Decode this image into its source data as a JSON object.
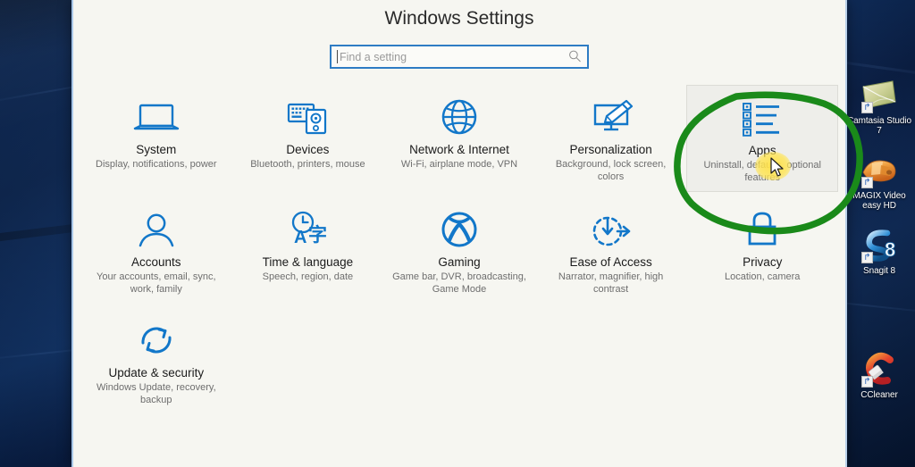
{
  "window": {
    "title": "Windows Settings"
  },
  "search": {
    "placeholder": "Find a setting",
    "value": "",
    "icon": "search-icon"
  },
  "tiles": [
    {
      "id": "system",
      "icon": "laptop-icon",
      "title": "System",
      "desc": "Display, notifications, power",
      "hover": false
    },
    {
      "id": "devices",
      "icon": "keyboard-device-icon",
      "title": "Devices",
      "desc": "Bluetooth, printers, mouse",
      "hover": false
    },
    {
      "id": "network-internet",
      "icon": "globe-icon",
      "title": "Network & Internet",
      "desc": "Wi-Fi, airplane mode, VPN",
      "hover": false
    },
    {
      "id": "personalization",
      "icon": "monitor-brush-icon",
      "title": "Personalization",
      "desc": "Background, lock screen, colors",
      "hover": false
    },
    {
      "id": "apps",
      "icon": "list-icon",
      "title": "Apps",
      "desc": "Uninstall, defaults, optional features",
      "hover": true
    },
    {
      "id": "accounts",
      "icon": "person-icon",
      "title": "Accounts",
      "desc": "Your accounts, email, sync, work, family",
      "hover": false
    },
    {
      "id": "time-language",
      "icon": "clock-language-icon",
      "title": "Time & language",
      "desc": "Speech, region, date",
      "hover": false
    },
    {
      "id": "gaming",
      "icon": "xbox-icon",
      "title": "Gaming",
      "desc": "Game bar, DVR, broadcasting, Game Mode",
      "hover": false
    },
    {
      "id": "ease-of-access",
      "icon": "ease-of-access-icon",
      "title": "Ease of Access",
      "desc": "Narrator, magnifier, high contrast",
      "hover": false
    },
    {
      "id": "privacy",
      "icon": "lock-icon",
      "title": "Privacy",
      "desc": "Location, camera",
      "hover": false
    },
    {
      "id": "update-security",
      "icon": "refresh-icon",
      "title": "Update & security",
      "desc": "Windows Update, recovery, backup",
      "hover": false
    }
  ],
  "desktop_icons": [
    {
      "id": "camtasia",
      "icon": "camtasia-studio-icon",
      "label": "Camtasia Studio 7",
      "badge": "↱"
    },
    {
      "id": "magix",
      "icon": "magix-video-easy-icon",
      "label": "MAGIX Video easy HD",
      "badge": "↱"
    },
    {
      "id": "snagit",
      "icon": "snagit-icon",
      "label": "Snagit 8",
      "badge": "↱"
    },
    {
      "id": "ccleaner",
      "icon": "ccleaner-icon",
      "label": "CCleaner",
      "badge": "↱"
    }
  ],
  "annotations": {
    "highlight_circle": {
      "shape": "hand-drawn-ellipse",
      "color": "#1a8a1a",
      "targets": "apps"
    },
    "click_blob": {
      "color": "#ffe149"
    },
    "cursor": {
      "type": "arrow-pointer"
    }
  },
  "colors": {
    "accent_blue": "#0078d7",
    "window_bg": "#f6f6f1",
    "annotation_green": "#1a8a1a",
    "highlight_yellow": "#ffe149",
    "desktop_blue": "#10336b"
  }
}
